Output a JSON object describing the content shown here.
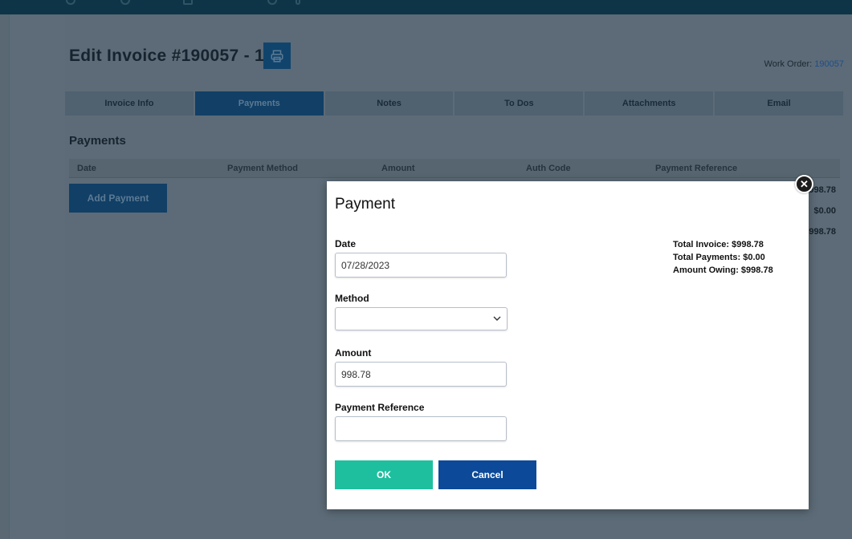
{
  "page": {
    "title": "Edit Invoice #190057 - 1",
    "work_order_label": "Work Order:",
    "work_order_number": "190057"
  },
  "tabs": [
    {
      "label": "Invoice Info"
    },
    {
      "label": "Payments"
    },
    {
      "label": "Notes"
    },
    {
      "label": "To Dos"
    },
    {
      "label": "Attachments"
    },
    {
      "label": "Email"
    }
  ],
  "active_tab": "Payments",
  "payments_section": {
    "title": "Payments",
    "columns": [
      "Date",
      "Payment Method",
      "Amount",
      "Auth Code",
      "Payment Reference"
    ],
    "add_button": "Add Payment",
    "side_totals": [
      "$998.78",
      "$0.00",
      "$998.78"
    ]
  },
  "modal": {
    "title": "Payment",
    "date_label": "Date",
    "date_value": "07/28/2023",
    "method_label": "Method",
    "method_value": "",
    "amount_label": "Amount",
    "amount_value": "998.78",
    "reference_label": "Payment Reference",
    "reference_value": "",
    "totals": {
      "total_invoice": "Total Invoice: $998.78",
      "total_payments": "Total Payments: $0.00",
      "amount_owing": "Amount Owing: $998.78"
    },
    "ok_label": "OK",
    "cancel_label": "Cancel"
  },
  "colors": {
    "primary": "#113f66",
    "ok": "#1dbf9f",
    "cancel": "#0c4a99",
    "link": "#1f4d8c"
  }
}
